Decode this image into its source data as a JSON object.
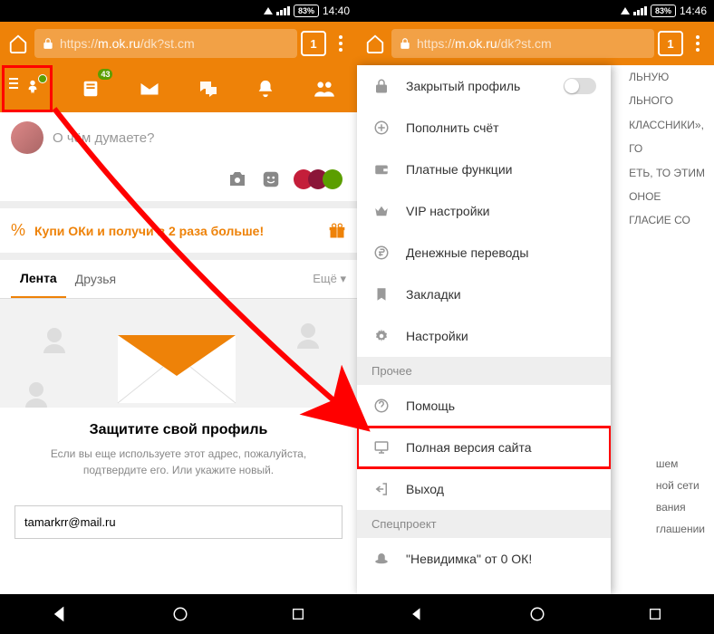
{
  "left": {
    "status": {
      "battery": "83%",
      "time": "14:40"
    },
    "url_prefix": "https://",
    "url_host": "m.ok.ru",
    "url_path": "/dk?st.cm",
    "tab_count": "1",
    "badge": "43",
    "composer_placeholder": "О чём думаете?",
    "promo": "Купи ОКи и получи в 2 раза больше!",
    "tabs": {
      "feed": "Лента",
      "friends": "Друзья",
      "more": "Ещё ▾"
    },
    "feature": {
      "title": "Защитите свой профиль",
      "desc": "Если вы еще используете этот адрес, пожалуйста, подтвердите его. Или укажите новый."
    },
    "email": "tamarkrr@mail.ru"
  },
  "right": {
    "status": {
      "battery": "83%",
      "time": "14:46"
    },
    "url_prefix": "https://",
    "url_host": "m.ok.ru",
    "url_path": "/dk?st.cm",
    "tab_count": "1",
    "menu": {
      "private_profile": "Закрытый профиль",
      "topup": "Пополнить счёт",
      "paid": "Платные функции",
      "vip": "VIP настройки",
      "transfers": "Денежные переводы",
      "bookmarks": "Закладки",
      "settings": "Настройки",
      "section_other": "Прочее",
      "help": "Помощь",
      "full_site": "Полная версия сайта",
      "logout": "Выход",
      "section_special": "Спецпроект",
      "invisible": "\"Невидимка\" от 0 ОК!"
    },
    "bg_fragments": [
      "ЛЬНУЮ",
      "ЛЬНОГО",
      "КЛАССНИКИ»,",
      "ГО",
      "ЕТЬ, ТО ЭТИМ",
      "ОНОЕ",
      "ГЛАСИЕ СО"
    ],
    "bg_fragments2": [
      "шем",
      "ной сети",
      "вания",
      "",
      "глашении"
    ]
  }
}
